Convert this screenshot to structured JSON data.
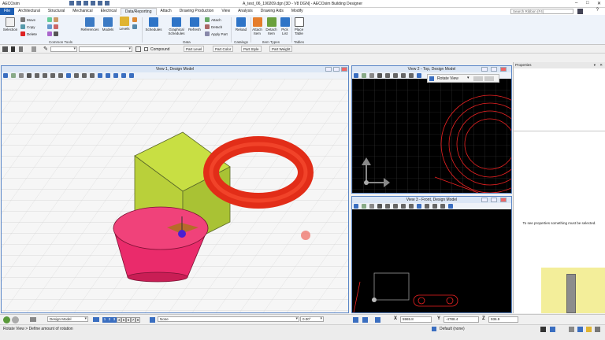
{
  "window": {
    "app_name": "AECOsim",
    "title": "A_test_06_190209.dgn [3D - V8 DGN] - AECOsim Building Designer"
  },
  "ribbon_tabs": [
    "File",
    "Architectural",
    "Structural",
    "Mechanical",
    "Electrical",
    "Data/Reporting",
    "Attach",
    "Drawing Production",
    "View",
    "Analysis",
    "Drawing Aids",
    "Modify"
  ],
  "active_tab": "Data/Reporting",
  "search": {
    "placeholder": "Search Ribbon (F4)"
  },
  "ribbon": {
    "selection": "Selection",
    "move": "Move",
    "copy": "Copy",
    "delete": "Delete",
    "references": "References",
    "models": "Models",
    "levels": "Levels",
    "common_tools": "Common Tools",
    "schedules": "Schedules",
    "graphical_schedules": "Graphical Schedules",
    "refresh": "Refresh",
    "attach": "Attach",
    "detach": "Detach",
    "apply_part": "Apply Part",
    "data": "Data",
    "reload": "Reload",
    "catalogs": "Catalogs",
    "attach_item": "Attach Item",
    "detach_item": "Detach Item",
    "pick_list": "Pick List",
    "item_types": "Item Types",
    "place_table": "Place Table",
    "tables": "Tables"
  },
  "attributes": {
    "compound": "Compound",
    "part_level": "Part Level",
    "part_color": "Part Color",
    "part_style": "Part Style",
    "part_weight": "Part Weight"
  },
  "views": {
    "v1": "View 1, Design Model",
    "v2": "View 2 - Top, Design Model",
    "v3": "View 3 - Front, Design Model"
  },
  "rotate_popup": "Rotate View",
  "properties": {
    "title": "Properties",
    "message": "To see properties something must be selected."
  },
  "status": {
    "model": "Design Model",
    "view_numbers": [
      "1",
      "2",
      "3",
      "4",
      "5",
      "6",
      "7",
      "8"
    ],
    "none_label": "None",
    "angle": "0.00°",
    "x_label": "X",
    "x_value": "5965.8",
    "y_label": "Y",
    "y_value": "-4788.4",
    "z_label": "Z",
    "z_value": "936.9",
    "prompt": "Rotate View > Define amount of rotation",
    "default_label": "Default (none)"
  },
  "colors": {
    "accent": "#1e5fb4",
    "torus": "#e8301c",
    "cone": "#ee2f6d",
    "cube": "#c4de3c"
  }
}
